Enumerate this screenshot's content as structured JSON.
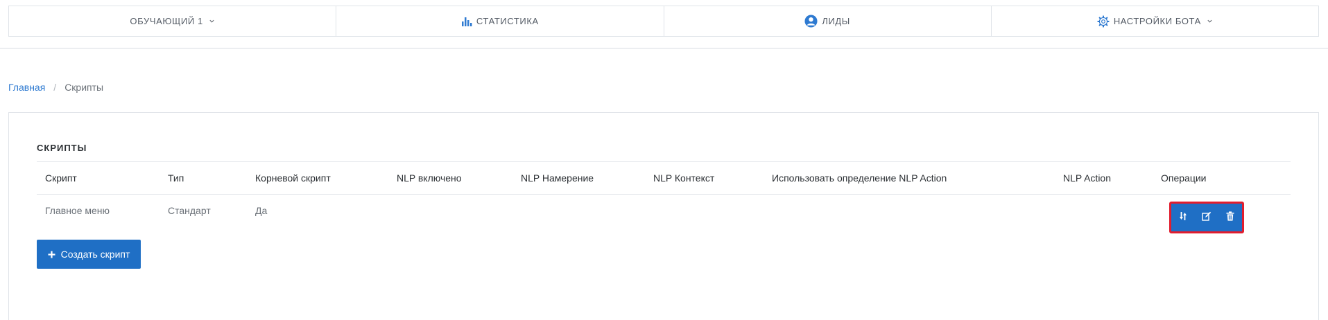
{
  "nav": {
    "items": [
      {
        "label": "ОБУЧАЮЩИЙ 1",
        "icon": "chevron-down-icon"
      },
      {
        "label": "СТАТИСТИКА",
        "icon": "bar-chart-icon"
      },
      {
        "label": "ЛИДЫ",
        "icon": "user-circle-icon"
      },
      {
        "label": "НАСТРОЙКИ БОТА",
        "icon": "gear-icon"
      }
    ],
    "accent": "#2e7ad1"
  },
  "breadcrumb": {
    "home": "Главная",
    "separator": "/",
    "current": "Скрипты"
  },
  "panel": {
    "title": "СКРИПТЫ",
    "columns": [
      "Скрипт",
      "Тип",
      "Корневой скрипт",
      "NLP включено",
      "NLP Намерение",
      "NLP Контекст",
      "Использовать определение NLP Action",
      "NLP Action",
      "Операции"
    ],
    "rows": [
      {
        "script": "Главное меню",
        "type": "Стандарт",
        "root": "Да",
        "nlp_enabled": "",
        "nlp_intent": "",
        "nlp_context": "",
        "use_nlp_action": "",
        "nlp_action": ""
      }
    ],
    "operations": [
      "reorder-icon",
      "edit-icon",
      "trash-icon"
    ],
    "create_button": "Создать скрипт",
    "button_color": "#1f6fc5",
    "highlight_color": "#e11d2e"
  }
}
